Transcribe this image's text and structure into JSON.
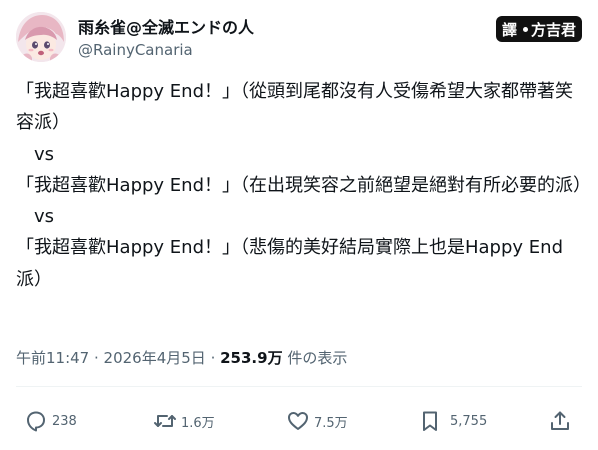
{
  "author": {
    "display_name": "雨糸雀@全滅エンドの人",
    "handle": "@RainyCanaria"
  },
  "watermark": {
    "left": "譯",
    "right": "方吉君"
  },
  "tweet": {
    "lines": [
      "「我超喜歡Happy End！」（從頭到尾都沒有人受傷希望大家都帶著笑容派）",
      "　vs",
      "「我超喜歡Happy End！」（在出現笑容之前絕望是絕對有所必要的派）",
      "　vs",
      "「我超喜歡Happy End！」（悲傷的美好結局實際上也是Happy End派）"
    ]
  },
  "meta": {
    "time": "午前11:47",
    "sep1": " · ",
    "date": "2026年4月5日",
    "sep2": " · ",
    "views": "253.9万",
    "views_suffix": " 件の表示"
  },
  "actions": {
    "replies": "238",
    "retweets": "1.6万",
    "likes": "7.5万",
    "bookmarks": "5,755"
  },
  "colors": {
    "text": "#0f1419",
    "secondary": "#536471",
    "divider": "#eff3f4"
  }
}
